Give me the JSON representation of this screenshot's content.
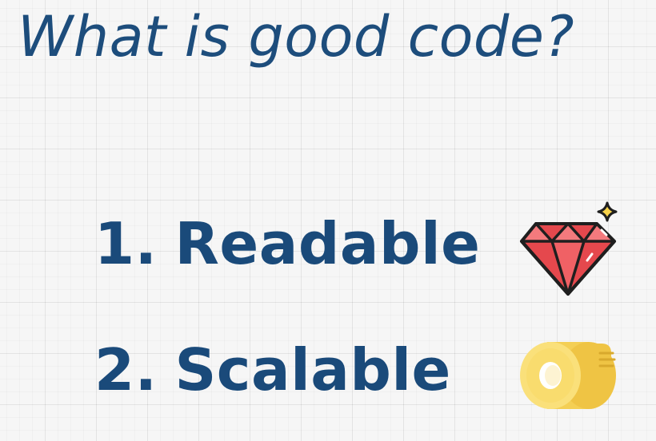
{
  "slide": {
    "title": "What is good code?",
    "items": [
      {
        "number": "1.",
        "label": "Readable",
        "icon": "gem-icon"
      },
      {
        "number": "2.",
        "label": "Scalable",
        "icon": "tape-icon"
      }
    ]
  },
  "colors": {
    "text": "#1a4a7a",
    "gem": "#e5484d",
    "gem_light": "#f47a7d",
    "sparkle": "#f7d24a",
    "tape": "#f9dc6e",
    "tape_dark": "#efc444",
    "outline": "#1f1f1f"
  }
}
